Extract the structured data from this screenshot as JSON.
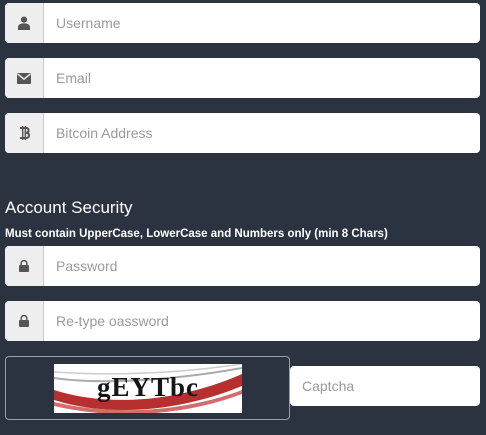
{
  "form": {
    "username": {
      "placeholder": "Username",
      "value": "",
      "icon": "user-icon"
    },
    "email": {
      "placeholder": "Email",
      "value": "",
      "icon": "envelope-icon"
    },
    "bitcoin": {
      "placeholder": "Bitcoin Address",
      "value": "",
      "icon": "bitcoin-icon"
    }
  },
  "security": {
    "title": "Account Security",
    "note": "Must contain UpperCase, LowerCase and Numbers only (min 8 Chars)",
    "password": {
      "placeholder": "Password",
      "value": "",
      "icon": "lock-icon"
    },
    "retype": {
      "placeholder": "Re-type oassword",
      "value": "",
      "icon": "lock-icon"
    }
  },
  "captcha": {
    "image_text": "gEYTbc",
    "input_placeholder": "Captcha",
    "input_value": ""
  },
  "colors": {
    "background": "#2c3340",
    "addon": "#eeeeee",
    "icon": "#555555",
    "captcha_swoosh": "#b01818"
  }
}
